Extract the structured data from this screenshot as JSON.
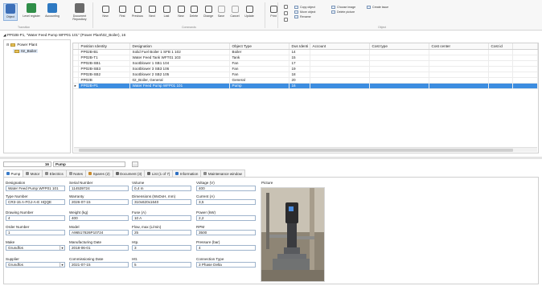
{
  "ribbon": {
    "buttons": [
      {
        "key": "object",
        "label": "Object",
        "color": "#3c6fb8"
      },
      {
        "key": "level_register",
        "label": "Level register",
        "color": "#2f8e48"
      },
      {
        "key": "accounting",
        "label": "Accounting",
        "color": "#2e79c2"
      },
      {
        "key": "document_repository",
        "label": "Document Repository",
        "color": "#6a6a6a"
      },
      {
        "key": "new",
        "label": "New",
        "color": "#555"
      },
      {
        "key": "first",
        "label": "First",
        "color": "#555"
      },
      {
        "key": "previous",
        "label": "Previous",
        "color": "#555"
      },
      {
        "key": "next",
        "label": "Next",
        "color": "#555"
      },
      {
        "key": "last",
        "label": "Last",
        "color": "#555"
      },
      {
        "key": "new2",
        "label": "New",
        "color": "#555"
      },
      {
        "key": "delete",
        "label": "Delete",
        "color": "#555"
      },
      {
        "key": "change",
        "label": "Change",
        "color": "#555"
      },
      {
        "key": "save",
        "label": "Save",
        "color": "#aaa"
      },
      {
        "key": "cancel",
        "label": "Cancel",
        "color": "#aaa"
      },
      {
        "key": "update",
        "label": "Update",
        "color": "#555"
      },
      {
        "key": "print",
        "label": "Print",
        "color": "#555"
      }
    ],
    "groups": {
      "transition": "Transition",
      "commands": "Commands",
      "object": "Object"
    },
    "small": {
      "copy_object": "Copy object",
      "move_object": "Move object",
      "rename": "Rename",
      "choose_image": "Choose image",
      "delete_picture": "Delete picture",
      "create_issue": "Create issue"
    }
  },
  "path": "PP02B-P1, \"Water Feed Pump WFP01 101\" (Power Plant\\02_Boiler), 16",
  "tree": {
    "root": "Power Plant",
    "child": "02_Boiler"
  },
  "grid": {
    "columns": [
      "Position Identity",
      "Designation",
      "Object Type",
      "Dus Identi",
      "Account",
      "Cost type",
      "Cost center",
      "Cost id"
    ],
    "rows": [
      [
        "PP02B-B1",
        "Solid Fuel Boiler 1 SFB 1 102",
        "Boiler",
        "14",
        "",
        "",
        "",
        ""
      ],
      [
        "PP02B-T1",
        "Water Feed Tank WFT01 103",
        "Tank",
        "15",
        "",
        "",
        "",
        ""
      ],
      [
        "PP02B-SB1",
        "Sootblower 1 SB1 104",
        "Fan",
        "17",
        "",
        "",
        "",
        ""
      ],
      [
        "PP02B-SB3",
        "Sootblower 3 SB3 106",
        "Fan",
        "19",
        "",
        "",
        "",
        ""
      ],
      [
        "PP02B-SB2",
        "Sootblower 2 SB2 105",
        "Fan",
        "18",
        "",
        "",
        "",
        ""
      ],
      [
        "PP02B",
        "02_Boiler, General",
        "General",
        "20",
        "",
        "",
        "",
        ""
      ],
      [
        "PP02B-P1",
        "Water Feed Pump WFP01 101",
        "Pump",
        "16",
        "",
        "",
        "",
        ""
      ]
    ],
    "selected_index": 6
  },
  "record": {
    "id": "16",
    "type": "Pump",
    "more": "..."
  },
  "tabs": [
    {
      "label": "Pump",
      "color": "#3a7bc8",
      "active": true
    },
    {
      "label": "Motor",
      "color": "#888"
    },
    {
      "label": "Electrics",
      "color": "#888"
    },
    {
      "label": "Notes",
      "color": "#999"
    },
    {
      "label": "Spares (2)",
      "color": "#c98a2a"
    },
    {
      "label": "Document (3)",
      "color": "#666"
    },
    {
      "label": "List (1 of 7)",
      "color": "#666"
    },
    {
      "label": "Information",
      "color": "#2e6fc2"
    },
    {
      "label": "Maintenance window",
      "color": "#888"
    }
  ],
  "form": {
    "designation": {
      "label": "Designation",
      "value": "Water Feed Pump WFP01 101"
    },
    "serial_number": {
      "label": "Serial Number",
      "value": "114539724"
    },
    "volume": {
      "label": "Volume",
      "value": "0,4 m"
    },
    "voltage": {
      "label": "Voltage (V)",
      "value": "400"
    },
    "type_number": {
      "label": "Type Number",
      "value": "CR3-15 A-FGJ-A-E HQQE"
    },
    "warranty": {
      "label": "Warranty",
      "value": "2026-07-15"
    },
    "dimensions": {
      "label": "Dimensions (WxDxH, mm)",
      "value": "310x620x1640"
    },
    "current": {
      "label": "Current (A)",
      "value": "3,5"
    },
    "drawing_number": {
      "label": "Drawing Number",
      "value": "4"
    },
    "weight": {
      "label": "Weight (kg)",
      "value": "400"
    },
    "fuse": {
      "label": "Fuse (A)",
      "value": "10 A"
    },
    "power": {
      "label": "Power (kW)",
      "value": "2,2"
    },
    "order_number": {
      "label": "Order Number",
      "value": "1"
    },
    "model": {
      "label": "Model",
      "value": "A96517826P10724"
    },
    "flow": {
      "label": "Flow, max (L/min)",
      "value": "25"
    },
    "rpm": {
      "label": "RPM",
      "value": "3500"
    },
    "make": {
      "label": "Make",
      "value": "Grundfos"
    },
    "manufacturing_date": {
      "label": "Manufacturing Date",
      "value": "2018-06-01"
    },
    "htp": {
      "label": "Htp.",
      "value": "3"
    },
    "pressure": {
      "label": "Pressure (bar)",
      "value": "4"
    },
    "supplier": {
      "label": "Supplier",
      "value": "Grundfos"
    },
    "commissioning_date": {
      "label": "Commissioning Date",
      "value": "2021-07-15"
    },
    "htt": {
      "label": "Htt.",
      "value": "5"
    },
    "connection_type": {
      "label": "Connection Type",
      "value": "3 Phase Delta"
    },
    "picture_label": "Picture"
  }
}
